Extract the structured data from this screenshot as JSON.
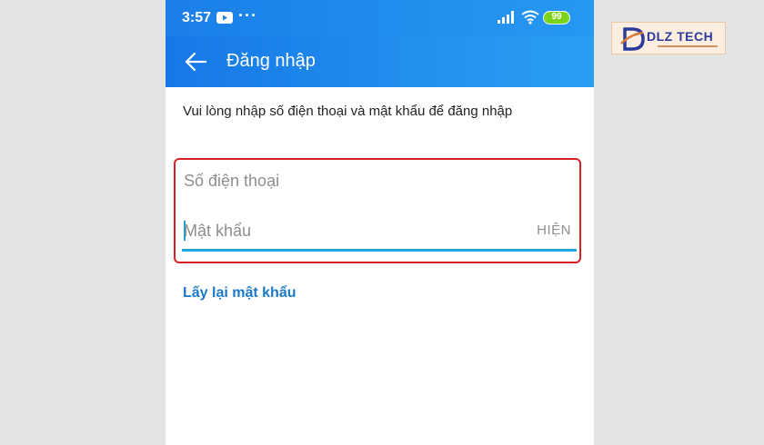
{
  "status_bar": {
    "time": "3:57",
    "more": "···",
    "battery": "99",
    "icons": [
      "youtube-icon",
      "more-icon",
      "signal-icon",
      "wifi-icon",
      "battery-icon"
    ]
  },
  "app_bar": {
    "title": "Đăng nhập",
    "back_icon": "back-arrow-icon"
  },
  "instruction": "Vui lòng nhập số điện thoại và mật khẩu để đăng nhập",
  "form": {
    "phone": {
      "placeholder": "Số điện thoại",
      "value": ""
    },
    "password": {
      "placeholder": "Mật khẩu",
      "value": "",
      "toggle_label": "HIỆN"
    },
    "highlight_color": "#d81f26",
    "underline_color": "#1da7df"
  },
  "forgot_password": "Lấy lại mật khẩu",
  "watermark": {
    "text": "DLZ TECH"
  },
  "colors": {
    "app_bar": "#1678e6",
    "link": "#1a79c8",
    "battery": "#7cd31c"
  }
}
